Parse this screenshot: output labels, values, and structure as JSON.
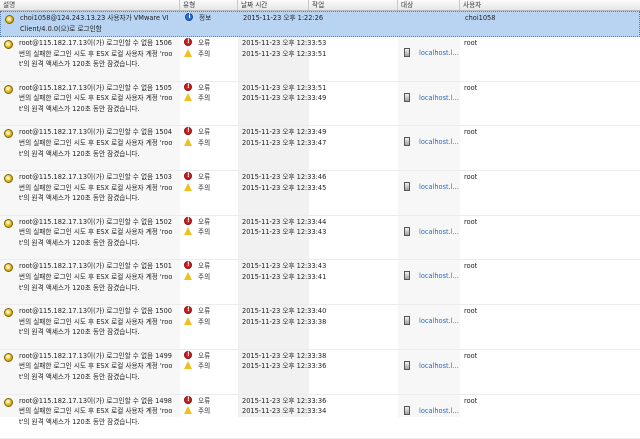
{
  "columns": [
    "설명",
    "유형",
    "날짜 시간",
    "작업",
    "대상",
    "사용자"
  ],
  "rows": [
    {
      "selected": true,
      "description": "choi1058@124.243.13.23 사용자가 VMware VI Client/4.0.0(으)로 로그인함",
      "severities": [
        {
          "kind": "info",
          "label": "정보"
        }
      ],
      "times": [
        "2015-11-23 오후 1:22:26"
      ],
      "target": "",
      "user": "choi1058"
    },
    {
      "selected": false,
      "description": "root@115.182.17.13이(가) 로그인할 수 없음 1506번의 실패한 로그인 시도 후 ESX 로컬 사용자 계정 'root'의 원격 액세스가 120초 동안 잠겼습니다.",
      "severities": [
        {
          "kind": "error",
          "label": "오류"
        },
        {
          "kind": "warn",
          "label": "주의"
        }
      ],
      "times": [
        "2015-11-23 오후 12:33:53",
        "2015-11-23 오후 12:33:51"
      ],
      "target": "localhost.l...",
      "user": "root"
    },
    {
      "selected": false,
      "description": "root@115.182.17.13이(가) 로그인할 수 없음 1505번의 실패한 로그인 시도 후 ESX 로컬 사용자 계정 'root'의 원격 액세스가 120초 동안 잠겼습니다.",
      "severities": [
        {
          "kind": "error",
          "label": "오류"
        },
        {
          "kind": "warn",
          "label": "주의"
        }
      ],
      "times": [
        "2015-11-23 오후 12:33:51",
        "2015-11-23 오후 12:33:49"
      ],
      "target": "localhost.l...",
      "user": "root"
    },
    {
      "selected": false,
      "description": "root@115.182.17.13이(가) 로그인할 수 없음 1504번의 실패한 로그인 시도 후 ESX 로컬 사용자 계정 'root'의 원격 액세스가 120초 동안 잠겼습니다.",
      "severities": [
        {
          "kind": "error",
          "label": "오류"
        },
        {
          "kind": "warn",
          "label": "주의"
        }
      ],
      "times": [
        "2015-11-23 오후 12:33:49",
        "2015-11-23 오후 12:33:47"
      ],
      "target": "localhost.l...",
      "user": "root"
    },
    {
      "selected": false,
      "description": "root@115.182.17.13이(가) 로그인할 수 없음 1503번의 실패한 로그인 시도 후 ESX 로컬 사용자 계정 'root'의 원격 액세스가 120초 동안 잠겼습니다.",
      "severities": [
        {
          "kind": "error",
          "label": "오류"
        },
        {
          "kind": "warn",
          "label": "주의"
        }
      ],
      "times": [
        "2015-11-23 오후 12:33:46",
        "2015-11-23 오후 12:33:45"
      ],
      "target": "localhost.l...",
      "user": "root"
    },
    {
      "selected": false,
      "description": "root@115.182.17.13이(가) 로그인할 수 없음 1502번의 실패한 로그인 시도 후 ESX 로컬 사용자 계정 'root'의 원격 액세스가 120초 동안 잠겼습니다.",
      "severities": [
        {
          "kind": "error",
          "label": "오류"
        },
        {
          "kind": "warn",
          "label": "주의"
        }
      ],
      "times": [
        "2015-11-23 오후 12:33:44",
        "2015-11-23 오후 12:33:43"
      ],
      "target": "localhost.l...",
      "user": "root"
    },
    {
      "selected": false,
      "description": "root@115.182.17.13이(가) 로그인할 수 없음 1501번의 실패한 로그인 시도 후 ESX 로컬 사용자 계정 'root'의 원격 액세스가 120초 동안 잠겼습니다.",
      "severities": [
        {
          "kind": "error",
          "label": "오류"
        },
        {
          "kind": "warn",
          "label": "주의"
        }
      ],
      "times": [
        "2015-11-23 오후 12:33:43",
        "2015-11-23 오후 12:33:41"
      ],
      "target": "localhost.l...",
      "user": "root"
    },
    {
      "selected": false,
      "description": "root@115.182.17.13이(가) 로그인할 수 없음 1500번의 실패한 로그인 시도 후 ESX 로컬 사용자 계정 'root'의 원격 액세스가 120초 동안 잠겼습니다.",
      "severities": [
        {
          "kind": "error",
          "label": "오류"
        },
        {
          "kind": "warn",
          "label": "주의"
        }
      ],
      "times": [
        "2015-11-23 오후 12:33:40",
        "2015-11-23 오후 12:33:38"
      ],
      "target": "localhost.l...",
      "user": "root"
    },
    {
      "selected": false,
      "description": "root@115.182.17.13이(가) 로그인할 수 없음 1499번의 실패한 로그인 시도 후 ESX 로컬 사용자 계정 'root'의 원격 액세스가 120초 동안 잠겼습니다.",
      "severities": [
        {
          "kind": "error",
          "label": "오류"
        },
        {
          "kind": "warn",
          "label": "주의"
        }
      ],
      "times": [
        "2015-11-23 오후 12:33:38",
        "2015-11-23 오후 12:33:36"
      ],
      "target": "localhost.l...",
      "user": "root"
    },
    {
      "selected": false,
      "description": "root@115.182.17.13이(가) 로그인할 수 없음 1498번의 실패한 로그인 시도 후 ESX 로컬 사용자 계정 'root'의 원격 액세스가 120초 동안 잠겼습니다.",
      "severities": [
        {
          "kind": "error",
          "label": "오류"
        },
        {
          "kind": "warn",
          "label": "주의"
        }
      ],
      "times": [
        "2015-11-23 오후 12:33:36",
        "2015-11-23 오후 12:33:34"
      ],
      "target": "localhost.l...",
      "user": "root"
    }
  ]
}
